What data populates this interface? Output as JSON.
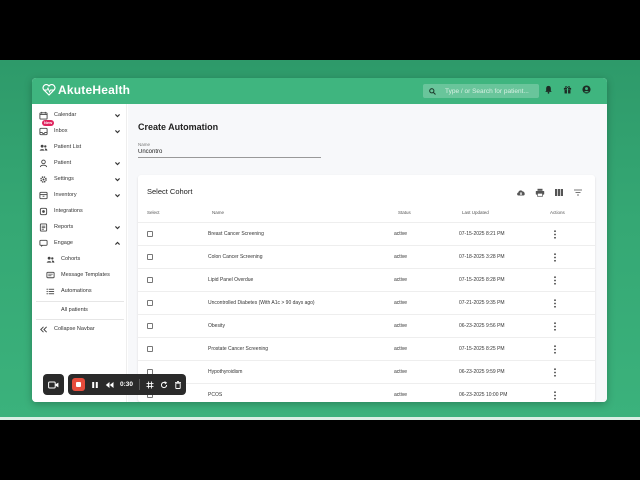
{
  "app": {
    "logo_text": "AkuteHealth",
    "search_placeholder": "Type / or Search for patient..."
  },
  "sidebar": {
    "items": [
      {
        "label": "Calendar",
        "icon": "calendar-icon",
        "expandable": true
      },
      {
        "label": "Inbox",
        "icon": "inbox-icon",
        "expandable": true,
        "badge": "New"
      },
      {
        "label": "Patient List",
        "icon": "people-icon",
        "expandable": false
      },
      {
        "label": "Patient",
        "icon": "person-icon",
        "expandable": true
      },
      {
        "label": "Settings",
        "icon": "gear-icon",
        "expandable": true
      },
      {
        "label": "Inventory",
        "icon": "inventory-icon",
        "expandable": true
      },
      {
        "label": "Integrations",
        "icon": "integrations-icon",
        "expandable": false
      },
      {
        "label": "Reports",
        "icon": "reports-icon",
        "expandable": true
      },
      {
        "label": "Engage",
        "icon": "engage-icon",
        "expandable": true,
        "expanded": true
      }
    ],
    "engage_sub": [
      {
        "label": "Cohorts",
        "icon": "cohorts-icon"
      },
      {
        "label": "Message Templates",
        "icon": "message-templates-icon"
      },
      {
        "label": "Automations",
        "icon": "automations-icon"
      }
    ],
    "all_patients": "All patients",
    "collapse": "Collapse Navbar"
  },
  "main": {
    "title": "Create Automation",
    "name_label": "Name",
    "name_value": "Uncontro"
  },
  "cohort": {
    "title": "Select Cohort",
    "columns": [
      "Select",
      "Name",
      "Status",
      "Last Updated",
      "Actions"
    ],
    "rows": [
      {
        "name": "Breast Cancer Screening",
        "status": "active",
        "updated": "07-15-2025 8:21 PM"
      },
      {
        "name": "Colon Cancer Screening",
        "status": "active",
        "updated": "07-18-2025 3:28 PM"
      },
      {
        "name": "Lipid Panel Overdue",
        "status": "active",
        "updated": "07-15-2025 8:28 PM"
      },
      {
        "name": "Uncontrolled Diabetes (With A1c > 90 days ago)",
        "status": "active",
        "updated": "07-21-2025 9:35 PM"
      },
      {
        "name": "Obesity",
        "status": "active",
        "updated": "06-23-2025 9:56 PM"
      },
      {
        "name": "Prostate Cancer Screening",
        "status": "active",
        "updated": "07-15-2025 8:25 PM"
      },
      {
        "name": "Hypothyroidism",
        "status": "active",
        "updated": "06-23-2025 9:59 PM"
      },
      {
        "name": "PCOS",
        "status": "active",
        "updated": "06-23-2025 10:00 PM"
      }
    ]
  },
  "recorder": {
    "time": "0:30"
  },
  "colors": {
    "brand_green": "#3fb57f",
    "record_red": "#e74c3c",
    "badge_pink": "#e0245e"
  }
}
